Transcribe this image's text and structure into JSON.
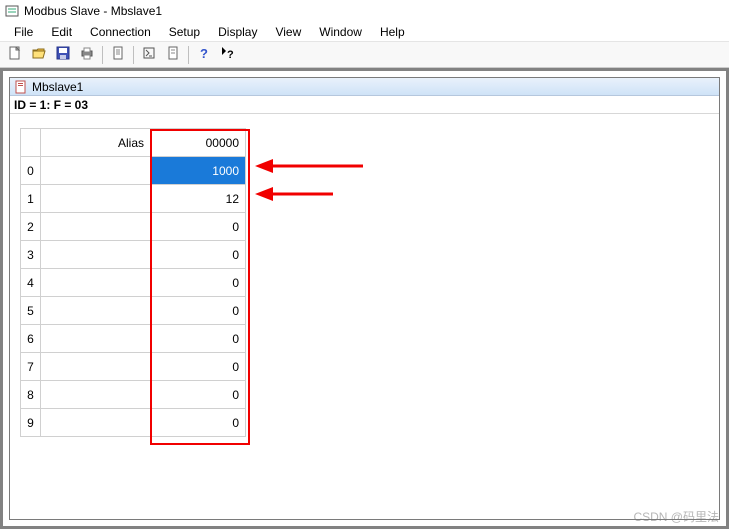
{
  "window": {
    "title": "Modbus Slave - Mbslave1"
  },
  "menu": {
    "items": [
      "File",
      "Edit",
      "Connection",
      "Setup",
      "Display",
      "View",
      "Window",
      "Help"
    ]
  },
  "toolbar": {
    "buttons": [
      {
        "name": "new-icon"
      },
      {
        "name": "open-icon"
      },
      {
        "name": "save-icon"
      },
      {
        "name": "print-icon"
      },
      {
        "sep": true
      },
      {
        "name": "document-icon"
      },
      {
        "sep": true
      },
      {
        "name": "connect-icon"
      },
      {
        "name": "disconnect-icon"
      },
      {
        "sep": true
      },
      {
        "name": "help-icon"
      },
      {
        "name": "context-help-icon"
      }
    ]
  },
  "doc": {
    "title": "Mbslave1",
    "status": "ID = 1: F = 03",
    "columns": {
      "index": "",
      "alias": "Alias",
      "value": "00000"
    },
    "rows": [
      {
        "index": "0",
        "alias": "",
        "value": "1000",
        "selected": true
      },
      {
        "index": "1",
        "alias": "",
        "value": "12"
      },
      {
        "index": "2",
        "alias": "",
        "value": "0"
      },
      {
        "index": "3",
        "alias": "",
        "value": "0"
      },
      {
        "index": "4",
        "alias": "",
        "value": "0"
      },
      {
        "index": "5",
        "alias": "",
        "value": "0"
      },
      {
        "index": "6",
        "alias": "",
        "value": "0"
      },
      {
        "index": "7",
        "alias": "",
        "value": "0"
      },
      {
        "index": "8",
        "alias": "",
        "value": "0"
      },
      {
        "index": "9",
        "alias": "",
        "value": "0"
      }
    ]
  },
  "watermark": "CSDN @码里法"
}
